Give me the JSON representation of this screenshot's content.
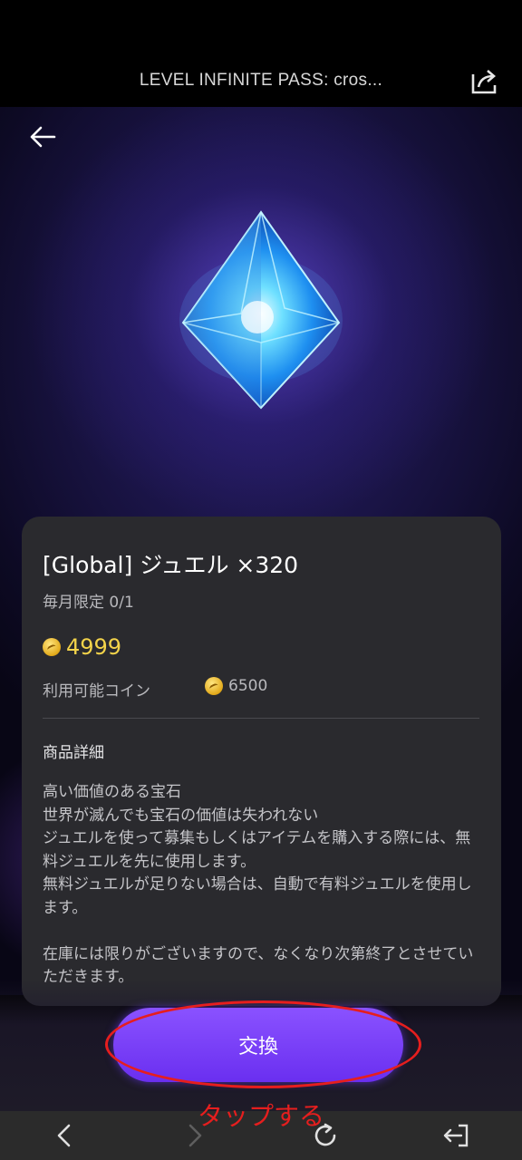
{
  "window": {
    "title": "LEVEL INFINITE PASS: cros..."
  },
  "icons": {
    "share": "share-icon",
    "back": "arrow-left-icon",
    "coin": "coin-icon",
    "nav_back": "chevron-left-icon",
    "nav_forward": "chevron-right-icon",
    "nav_reload": "reload-icon",
    "nav_exit": "exit-icon"
  },
  "item": {
    "name": "[Global] ジュエル ×320",
    "limit": "毎月限定 0/1",
    "price": "4999",
    "available_label": "利用可能コイン",
    "available_value": "6500",
    "detail_heading": "商品詳細",
    "detail_text": "高い価値のある宝石\n世界が滅んでも宝石の価値は失われない\nジュエルを使って募集もしくはアイテムを購入する際には、無料ジュエルを先に使用します。\n無料ジュエルが足りない場合は、自動で有料ジュエルを使用します。\n\n在庫には限りがございますので、なくなり次第終了とさせていただきます。"
  },
  "actions": {
    "exchange_label": "交換"
  },
  "annotation": {
    "text": "タップする",
    "color": "#e61e1e"
  },
  "colors": {
    "accent": "#7a3cff",
    "price": "#f3d34a",
    "card_bg": "#2a2a2e"
  }
}
